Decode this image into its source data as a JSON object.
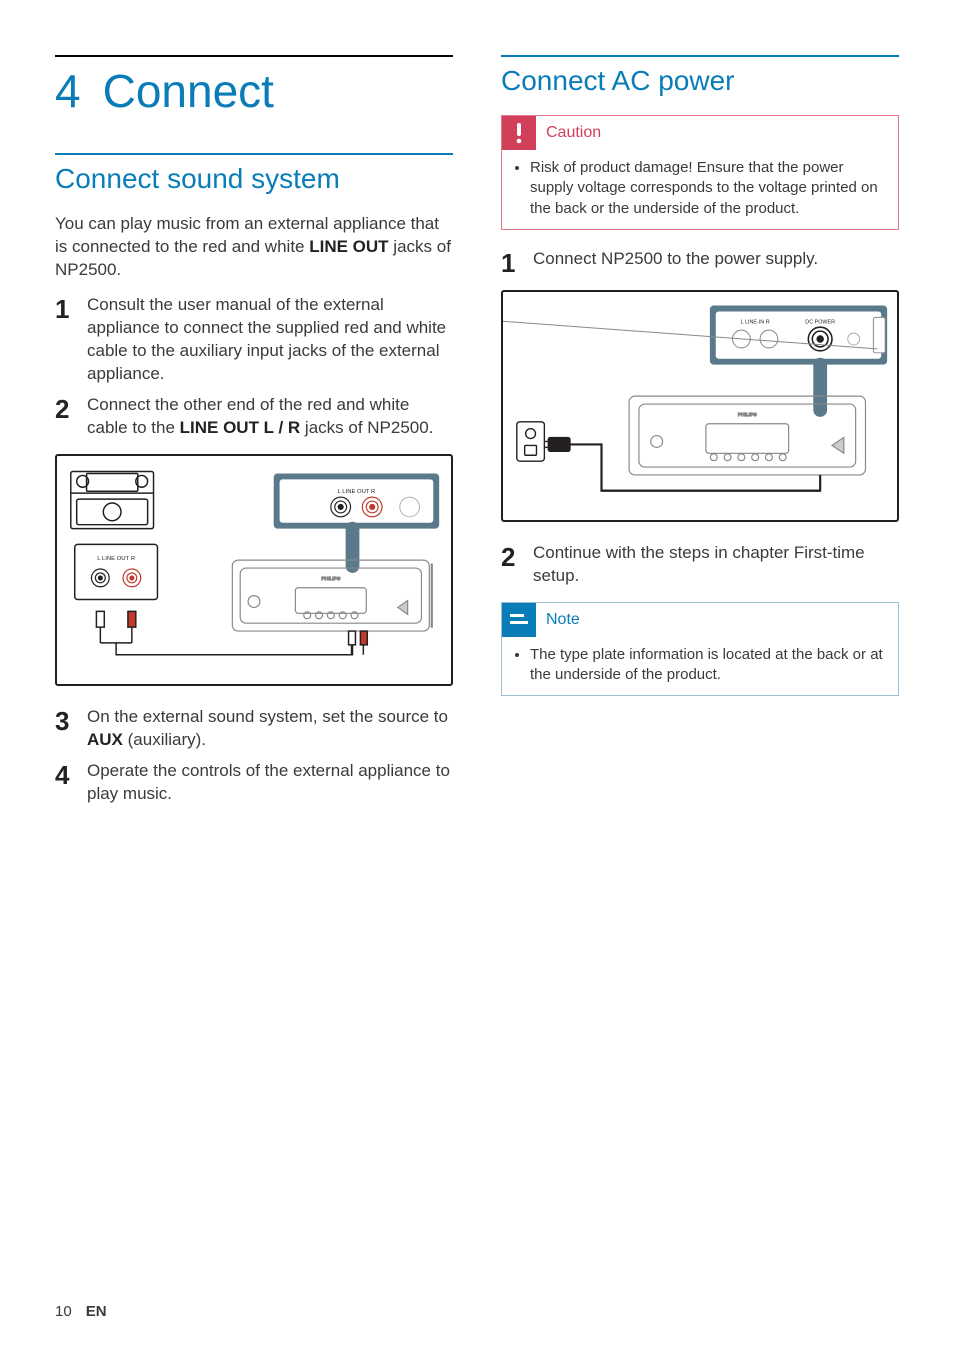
{
  "chapter": {
    "number": "4",
    "title": "Connect"
  },
  "left": {
    "section_title": "Connect sound system",
    "intro_a": "You can play music from an external appliance that is connected to the red and white ",
    "intro_bold": "LINE OUT",
    "intro_b": " jacks of NP2500.",
    "steps": {
      "1": "Consult the user manual of the external appliance to connect the supplied red and white cable to the auxiliary input jacks of the external appliance.",
      "2a": "Connect the other end of the red and white cable to the ",
      "2bold": "LINE OUT L / R",
      "2b": " jacks of NP2500.",
      "3a": "On the external sound system, set the source to ",
      "3bold": "AUX",
      "3b": " (auxiliary).",
      "4": "Operate the controls of the external appliance to play music."
    }
  },
  "right": {
    "section_title": "Connect AC power",
    "caution_label": "Caution",
    "caution_text": "Risk of product damage! Ensure that the power supply voltage corresponds to the voltage printed on the back or the underside of the product.",
    "step1": "Connect NP2500 to the power supply.",
    "step2": "Continue with the steps in chapter First-time setup.",
    "note_label": "Note",
    "note_text": "The type plate information is located at the back or at the underside of the product."
  },
  "fig1_labels": {
    "lineout": "L  LINE OUT  R",
    "b_lineout": "L  LINE OUT  R",
    "philips": "PHILIPS"
  },
  "fig2_labels": {
    "linein": "L   LINE-IN   R",
    "dcpower": "DC POWER",
    "philips": "PHILIPS"
  },
  "footer": {
    "page": "10",
    "lang": "EN"
  }
}
